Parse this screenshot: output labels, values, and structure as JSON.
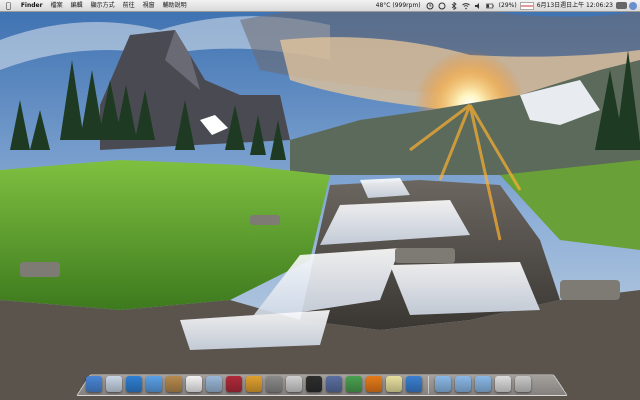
{
  "menubar": {
    "apple": "",
    "app": "Finder",
    "menus": [
      "檔案",
      "編輯",
      "顯示方式",
      "前往",
      "視窗",
      "輔助說明"
    ],
    "status": {
      "temp": "48°C (999rpm)",
      "battery": "(29%)",
      "datetime": "6月13日週日上午 12:06:23"
    }
  },
  "dock": {
    "items": [
      {
        "name": "finder",
        "color": "#4a86d6"
      },
      {
        "name": "preview",
        "color": "#c9d6e6"
      },
      {
        "name": "safari",
        "color": "#2f7fd4"
      },
      {
        "name": "ichat",
        "color": "#5aa0e6"
      },
      {
        "name": "address-book",
        "color": "#b58a4e"
      },
      {
        "name": "ical",
        "color": "#f2f2f2"
      },
      {
        "name": "iphoto",
        "color": "#9ab8d6"
      },
      {
        "name": "itunes",
        "color": "#b02a3a"
      },
      {
        "name": "photo-booth",
        "color": "#e0a030"
      },
      {
        "name": "system-preferences",
        "color": "#8a8a8a"
      },
      {
        "name": "script-editor",
        "color": "#d0d0d0"
      },
      {
        "name": "terminal",
        "color": "#2d2d2d"
      },
      {
        "name": "dictionary",
        "color": "#5a6fa0"
      },
      {
        "name": "activity-monitor",
        "color": "#4aa050"
      },
      {
        "name": "firefox",
        "color": "#e67a1a"
      },
      {
        "name": "stickies",
        "color": "#e8e0a0"
      },
      {
        "name": "app-store",
        "color": "#3a7fd0"
      },
      {
        "name": "folder-applications",
        "color": "#8ab8e6"
      },
      {
        "name": "folder-documents",
        "color": "#8ab8e6"
      },
      {
        "name": "folder-downloads",
        "color": "#8ab8e6"
      },
      {
        "name": "mail",
        "color": "#dcdcdc"
      },
      {
        "name": "trash",
        "color": "#c8c8c8"
      }
    ]
  }
}
